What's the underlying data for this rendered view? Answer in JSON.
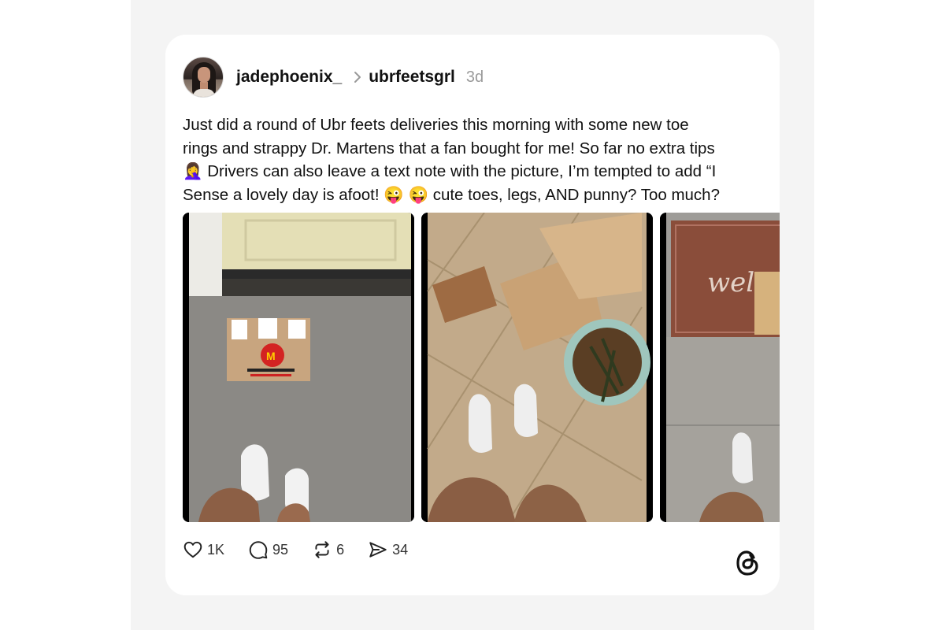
{
  "post": {
    "author": "jadephoenix_",
    "reply_to": "ubrfeetsgrl",
    "time": "3d",
    "text_lines": [
      "Just did a round of Ubr feets deliveries this morning with some new toe",
      "rings and strappy Dr. Martens that a fan bought for me! So far no extra tips",
      "🤦‍♀️  Drivers can also leave a text note with the picture, I’m tempted to add “I",
      "Sense a lovely day is afoot! 😜 😜  cute toes, legs, AND punny? Too much?"
    ]
  },
  "stats": {
    "likes": "1K",
    "replies": "95",
    "reposts": "6",
    "shares": "34"
  },
  "icons": {
    "like": "heart-icon",
    "reply": "comment-bubble-icon",
    "repost": "repost-icon",
    "share": "send-icon",
    "brand": "threads-logo-icon"
  },
  "colors": {
    "backdrop": "#f4f4f4",
    "card": "#ffffff",
    "muted": "#9a9a9a"
  }
}
